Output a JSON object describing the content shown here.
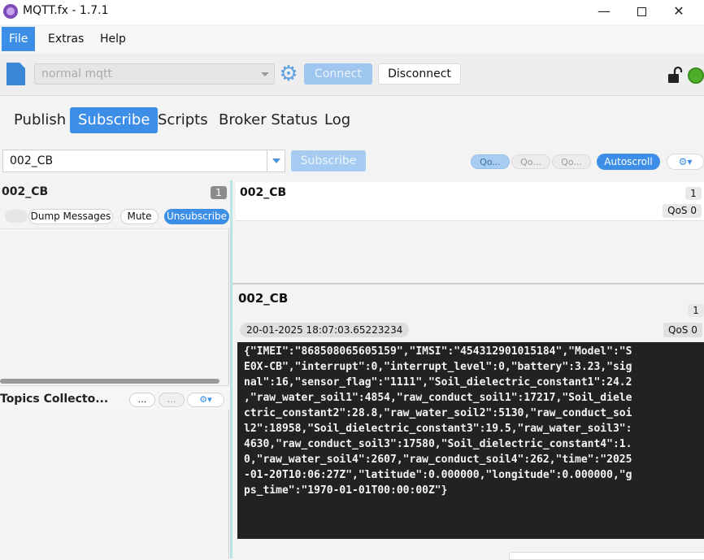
{
  "window": {
    "title": "MQTT.fx - 1.7.1",
    "min_glyph": "—",
    "close_glyph": "✕"
  },
  "menu": [
    "File",
    "Extras",
    "Help"
  ],
  "toolbar": {
    "profile": "normal mqtt",
    "connect_label": "Connect",
    "disconnect_label": "Disconnect",
    "status_color": "#4cae2a"
  },
  "tabs": [
    "Publish",
    "Subscribe",
    "Scripts",
    "Broker Status",
    "Log"
  ],
  "subscribe_bar": {
    "topic": "002_CB",
    "subscribe_label": "Subscribe",
    "qos": [
      "Qo...",
      "Qo...",
      "Qo..."
    ],
    "autoscroll_label": "Autoscroll"
  },
  "subscriptions": [
    {
      "topic": "002_CB",
      "count": "1",
      "dump_label": "Dump Messages",
      "mute_label": "Mute",
      "unsubscribe_label": "Unsubscribe"
    }
  ],
  "topics_collector": {
    "label": "Topics Collecto...",
    "btn_a": "...",
    "btn_b": "..."
  },
  "message_list": [
    {
      "topic": "002_CB",
      "number": "1",
      "qos": "QoS 0"
    }
  ],
  "detail": {
    "topic": "002_CB",
    "number": "1",
    "timestamp": "20-01-2025  18:07:03.65223234",
    "qos": "QoS 0",
    "payload": "{\"IMEI\":\"868508065605159\",\"IMSI\":\"454312901015184\",\"Model\":\"S\nE0X-CB\",\"interrupt\":0,\"interrupt_level\":0,\"battery\":3.23,\"sig\nnal\":16,\"sensor_flag\":\"1111\",\"Soil_dielectric_constant1\":24.2\n,\"raw_water_soil1\":4854,\"raw_conduct_soil1\":17217,\"Soil_diele\nctric_constant2\":28.8,\"raw_water_soil2\":5130,\"raw_conduct_soi\nl2\":18958,\"Soil_dielectric_constant3\":19.5,\"raw_water_soil3\":\n4630,\"raw_conduct_soil3\":17580,\"Soil_dielectric_constant4\":1.\n0,\"raw_water_soil4\":2607,\"raw_conduct_soil4\":262,\"time\":\"2025\n-01-20T10:06:27Z\",\"latitude\":0.000000,\"longitude\":0.000000,\"g\nps_time\":\"1970-01-01T00:00:00Z\"}"
  }
}
